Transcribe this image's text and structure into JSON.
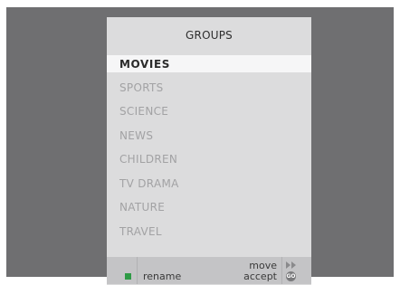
{
  "menu": {
    "title": "GROUPS",
    "items": [
      {
        "label": "MOVIES",
        "selected": true
      },
      {
        "label": "SPORTS",
        "selected": false
      },
      {
        "label": "SCIENCE",
        "selected": false
      },
      {
        "label": "NEWS",
        "selected": false
      },
      {
        "label": "CHILDREN",
        "selected": false
      },
      {
        "label": "TV  DRAMA",
        "selected": false
      },
      {
        "label": "NATURE",
        "selected": false
      },
      {
        "label": "TRAVEL",
        "selected": false
      }
    ]
  },
  "footer": {
    "rename_label": "rename",
    "move_label": "move",
    "accept_label": "accept",
    "go_label": "GO",
    "green_button_color": "#2e9a45",
    "forward_icon": "fast-forward-icon",
    "go_icon": "go-button-icon"
  },
  "colors": {
    "background": "#6f6f71",
    "panel": "#dcdcdd",
    "selected_row": "#f6f6f7",
    "footer": "#c4c4c6"
  }
}
